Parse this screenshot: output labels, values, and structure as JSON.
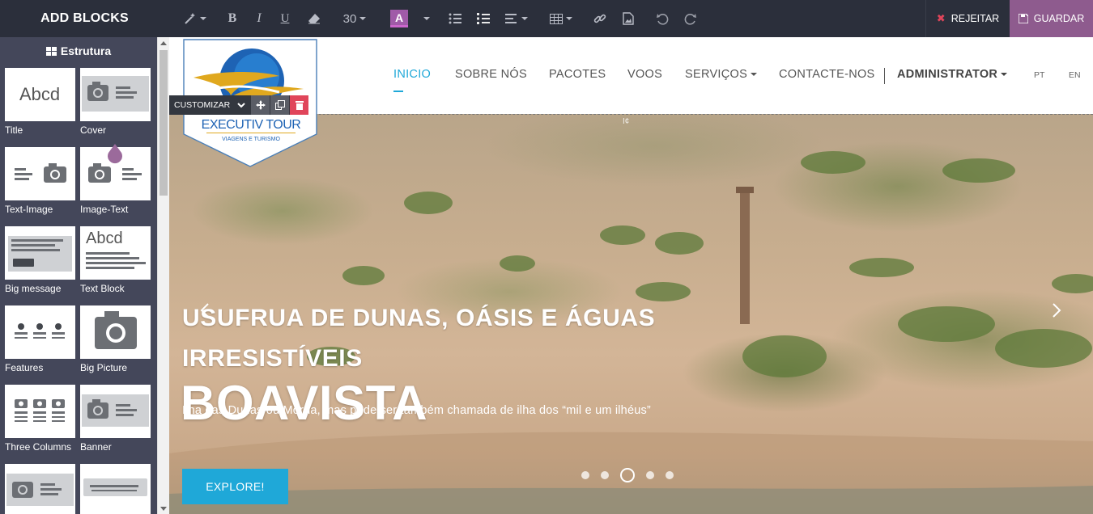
{
  "sidebar": {
    "header": "ADD BLOCKS",
    "section_title": "Estrutura",
    "blocks": [
      {
        "label": "Title"
      },
      {
        "label": "Cover"
      },
      {
        "label": "Text-Image"
      },
      {
        "label": "Image-Text"
      },
      {
        "label": "Big message"
      },
      {
        "label": "Text Block"
      },
      {
        "label": "Features"
      },
      {
        "label": "Big Picture"
      },
      {
        "label": "Three Columns"
      },
      {
        "label": "Banner"
      }
    ],
    "title_thumb_text": "Abcd",
    "text_block_thumb_text": "Abcd"
  },
  "toolbar": {
    "font_size": "30",
    "color_letter": "A",
    "reject_label": "REJEITAR",
    "save_label": "GUARDAR",
    "icons": [
      "magic-wand-icon",
      "bold-icon",
      "italic-icon",
      "underline-icon",
      "eraser-icon",
      "font-color-icon",
      "bullet-list-icon",
      "numbered-list-icon",
      "align-icon",
      "table-icon",
      "link-icon",
      "image-icon",
      "undo-icon",
      "redo-icon"
    ],
    "bold_letter": "B",
    "italic_letter": "I",
    "underline_letter": "U"
  },
  "customize": {
    "label": "CUSTOMIZAR"
  },
  "nav": {
    "items": [
      "INICIO",
      "SOBRE NÓS",
      "PACOTES",
      "VOOS",
      "SERVIÇOS",
      "CONTACTE-NOS"
    ],
    "admin": "ADMINISTRATOR",
    "lang_pt": "PT",
    "lang_en": "EN"
  },
  "logo": {
    "name": "EXECUTIV TOUR",
    "tagline": "VIAGENS E TURISMO"
  },
  "hero": {
    "heading_line1": "USUFRUA DE DUNAS, OÁSIS E ÁGUAS",
    "heading_line2": "IRRESISTÍVEIS",
    "title": "BOAVISTA",
    "subtitle": "Ilha das Dunas ou Morna, mas pode ser também chamada de ilha dos “mil e um ilhéus”",
    "button": "EXPLORE!",
    "slides": 5,
    "active_slide": 3,
    "marker": "I¢"
  },
  "colors": {
    "topbar_bg": "#2b2f3b",
    "sidebar_bg": "#44475a",
    "accent": "#1fa8d8",
    "save_bg": "#8e5b8e",
    "reject_x": "#e0455a"
  }
}
